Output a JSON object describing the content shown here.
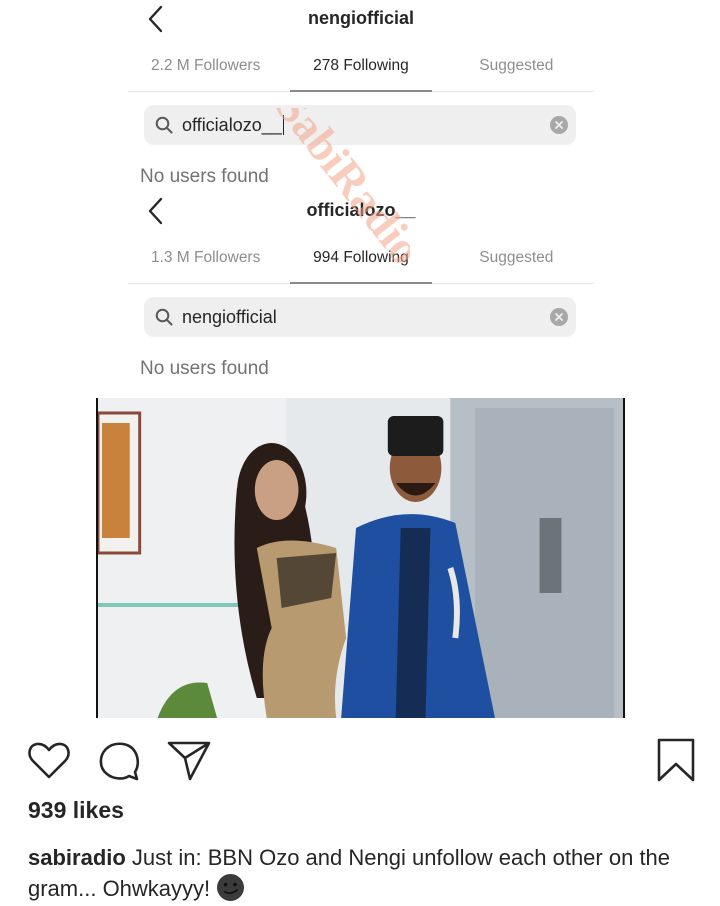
{
  "panels": [
    {
      "username": "nengiofficial",
      "tabs": [
        "2.2 M Followers",
        "278 Following",
        "Suggested"
      ],
      "active_tab": 1,
      "search_value": "officialozo__",
      "empty_text": "No users found"
    },
    {
      "username": "officialozo__",
      "tabs": [
        "1.3 M Followers",
        "994 Following",
        "Suggested"
      ],
      "active_tab": 1,
      "search_value": "nengiofficial",
      "empty_text": "No users found"
    }
  ],
  "watermark": "SabiRadio",
  "post": {
    "likes": "939 likes",
    "caption_user": "sabiradio",
    "caption_text": " Just in: BBN Ozo and Nengi unfollow each other on the gram... Ohwkayyy! "
  },
  "icons": {
    "back": "chevron-left-icon",
    "search": "search-icon",
    "clear": "clear-icon",
    "like": "heart-icon",
    "comment": "comment-icon",
    "share": "share-icon",
    "save": "bookmark-icon",
    "emoji": "smirking-emoji-icon"
  },
  "colors": {
    "text": "#262626",
    "muted": "#8e8e8e",
    "search_bg": "#efefef",
    "watermark": "#f2a488"
  }
}
